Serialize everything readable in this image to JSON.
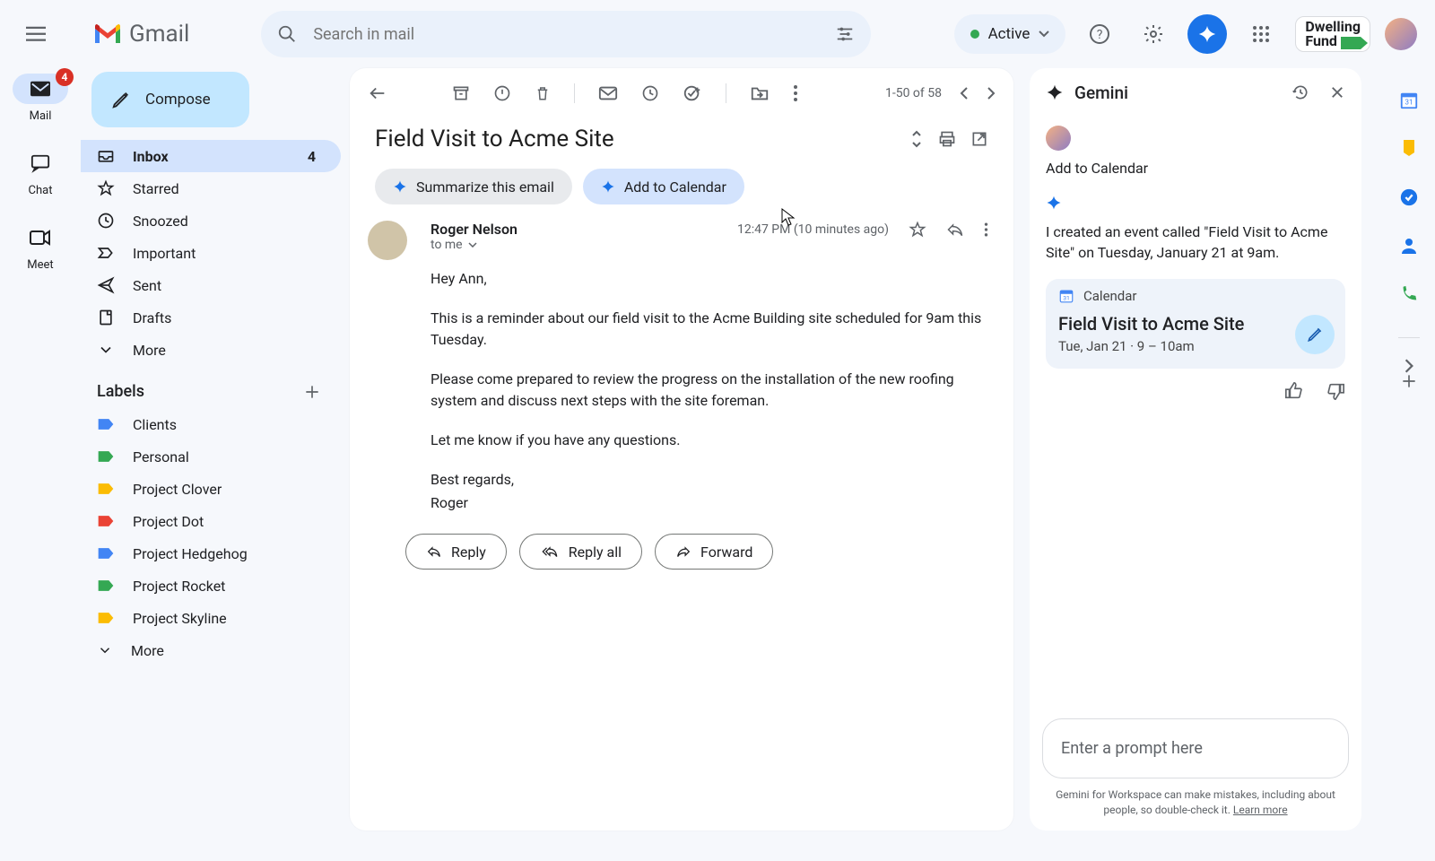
{
  "app": {
    "name": "Gmail"
  },
  "search": {
    "placeholder": "Search in mail"
  },
  "status": {
    "active": "Active"
  },
  "org": {
    "badge_line1": "Dwelling",
    "badge_line2": "Fund"
  },
  "rail": {
    "mail": "Mail",
    "chat": "Chat",
    "meet": "Meet",
    "mail_badge": "4"
  },
  "compose": {
    "label": "Compose"
  },
  "folders": [
    {
      "icon": "inbox",
      "label": "Inbox",
      "count": "4",
      "selected": true
    },
    {
      "icon": "star",
      "label": "Starred"
    },
    {
      "icon": "clock",
      "label": "Snoozed"
    },
    {
      "icon": "important",
      "label": "Important"
    },
    {
      "icon": "send",
      "label": "Sent"
    },
    {
      "icon": "draft",
      "label": "Drafts"
    },
    {
      "icon": "more",
      "label": "More"
    }
  ],
  "labels_header": "Labels",
  "labels": [
    {
      "name": "Clients",
      "color": "#4285f4"
    },
    {
      "name": "Personal",
      "color": "#34a853"
    },
    {
      "name": "Project Clover",
      "color": "#fbbc04"
    },
    {
      "name": "Project Dot",
      "color": "#ea4335"
    },
    {
      "name": "Project Hedgehog",
      "color": "#4285f4"
    },
    {
      "name": "Project Rocket",
      "color": "#34a853"
    },
    {
      "name": "Project Skyline",
      "color": "#fbbc04"
    }
  ],
  "labels_more": "More",
  "toolbar": {
    "pager": "1-50 of 58"
  },
  "message": {
    "subject": "Field Visit to Acme Site",
    "chip_summarize": "Summarize this email",
    "chip_add_calendar": "Add to Calendar",
    "sender": "Roger Nelson",
    "to": "to me",
    "timestamp": "12:47 PM (10 minutes ago)",
    "body": {
      "p1": "Hey Ann,",
      "p2": "This is a reminder about our field visit to the Acme Building site scheduled for 9am this Tuesday.",
      "p3": "Please come prepared to review the progress on the installation of the new roofing system and discuss next steps with the site foreman.",
      "p4": "Let me know if you have any questions.",
      "p5": "Best regards,",
      "p6": "Roger"
    },
    "reply": "Reply",
    "reply_all": "Reply all",
    "forward": "Forward"
  },
  "gemini": {
    "title": "Gemini",
    "user_prompt": "Add to Calendar",
    "response": "I created an event called \"Field Visit to Acme Site\" on Tuesday, January 21 at 9am.",
    "calendar_label": "Calendar",
    "event_title": "Field Visit to Acme Site",
    "event_time": "Tue, Jan 21 · 9 – 10am",
    "prompt_placeholder": "Enter a prompt here",
    "disclaimer_text": "Gemini for Workspace can make mistakes, including about people, so double-check it. ",
    "disclaimer_link": "Learn more"
  }
}
